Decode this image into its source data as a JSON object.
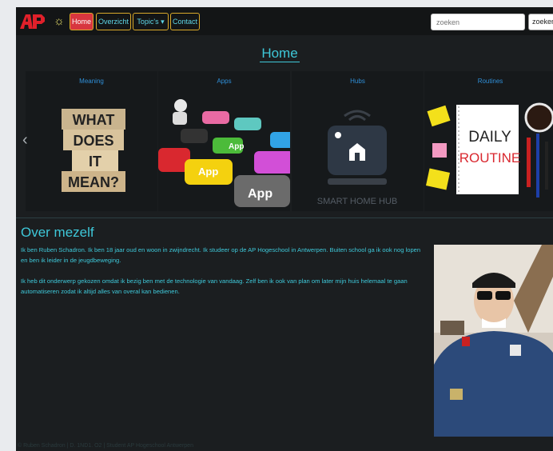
{
  "nav": {
    "items": [
      {
        "label": "Home",
        "active": true
      },
      {
        "label": "Overzicht"
      },
      {
        "label": "Topic's ▾"
      },
      {
        "label": "Contact"
      }
    ],
    "logo_icon": "ap-logo",
    "theme_icon": "sun-icon",
    "search_placeholder": "zoeken",
    "search_button": "zoeken"
  },
  "page_title": "Home",
  "carousel": {
    "slides": [
      {
        "label": "Meaning",
        "image_text": [
          "WHAT",
          "DOES",
          "IT",
          "MEAN?"
        ]
      },
      {
        "label": "Apps",
        "image_text": "App"
      },
      {
        "label": "Hubs",
        "image_text": "SMART HOME HUB"
      },
      {
        "label": "Routines",
        "image_text": [
          "DAILY",
          "ROUTINE"
        ]
      }
    ],
    "prev_icon": "chevron-left-icon"
  },
  "about": {
    "heading": "Over mezelf",
    "p1": "Ik ben Ruben Schadron. Ik ben 18 jaar oud en woon in zwijndrecht. Ik studeer op de AP Hogeschool in Antwerpen. Buiten school ga ik ook nog lopen en ben ik leider in de jeugdbeweging.",
    "p2": "Ik heb dit onderwerp gekozen omdat ik bezig ben met de technologie van vandaag. Zelf ben ik ook van plan om later mijn huis helemaal te gaan automatiseren zodat ik altijd alles van overal kan bedienen."
  },
  "footer": "© Ruben Schadron | D. 1ND1. O2 | Student AP Hogeschool Antwerpen",
  "colors": {
    "accent": "#3ec8d9",
    "active": "#d8363f",
    "border": "#d9a92a",
    "background": "#1b1e20"
  }
}
